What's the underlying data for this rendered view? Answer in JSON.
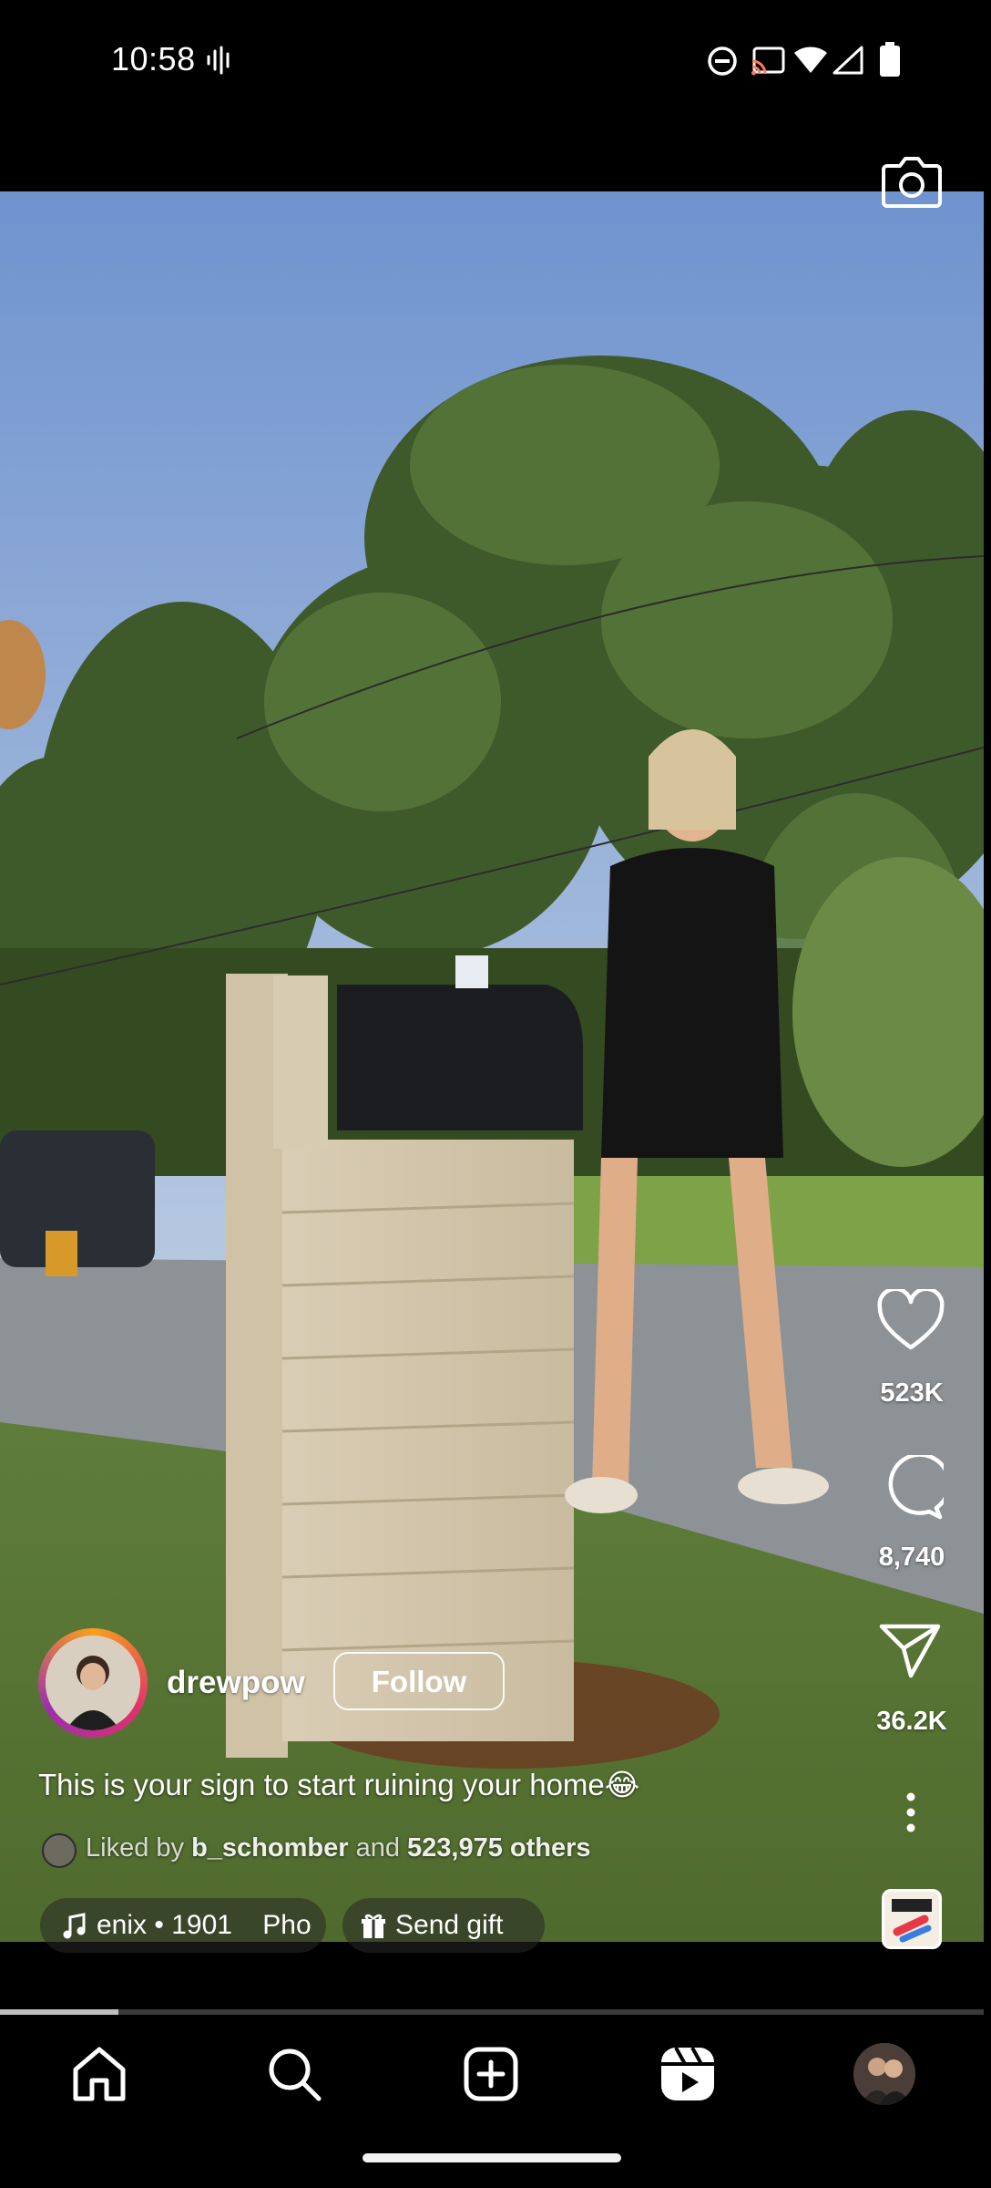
{
  "status_bar": {
    "time": "10:58",
    "icons": [
      "voice-recording-icon",
      "do-not-disturb-icon",
      "cast-icon",
      "wifi-icon",
      "signal-icon",
      "battery-icon"
    ]
  },
  "top": {
    "camera_icon": "camera-icon"
  },
  "actions": {
    "like_count": "523K",
    "comment_count": "8,740",
    "share_count": "36.2K"
  },
  "post": {
    "username": "drewpow",
    "follow_label": "Follow",
    "caption": "This is your sign to start ruining your home😂",
    "liked_by_prefix": "Liked by",
    "liked_by_user": "b_schomber",
    "liked_by_and": "and",
    "liked_by_others": "523,975 others"
  },
  "chips": {
    "music_text": "enix • 1901    Pho",
    "gift_label": "Send gift"
  },
  "playback": {
    "progress": 0.12
  },
  "bottom_nav": {
    "items": [
      "home-icon",
      "search-icon",
      "create-icon",
      "reels-icon",
      "profile-avatar"
    ],
    "active": "reels"
  },
  "colors": {
    "background": "#000000",
    "text": "#ffffff",
    "story_ring": [
      "#f9a01b",
      "#e1306c",
      "#9b2fae"
    ]
  }
}
